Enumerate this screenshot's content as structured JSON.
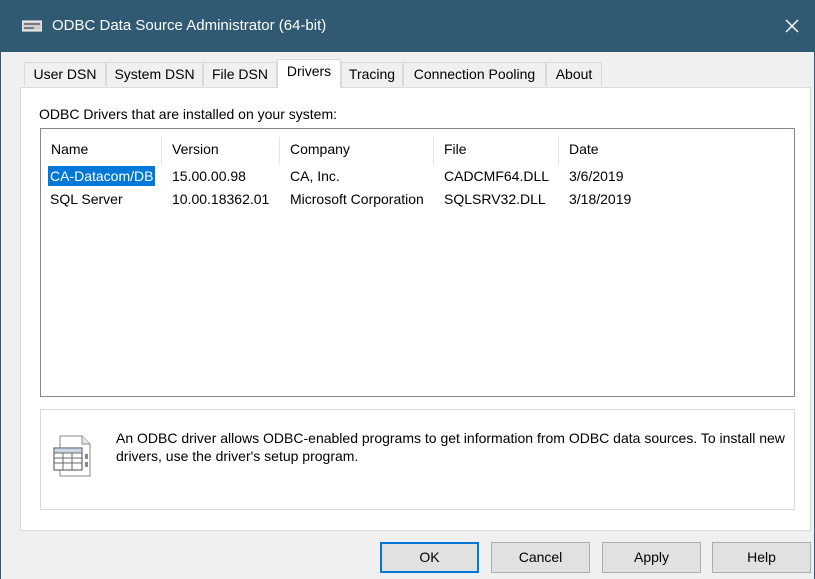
{
  "window": {
    "title": "ODBC Data Source Administrator (64-bit)",
    "close_glyph": "✕"
  },
  "tabs": [
    {
      "label": "User DSN"
    },
    {
      "label": "System DSN"
    },
    {
      "label": "File DSN"
    },
    {
      "label": "Drivers",
      "active": true
    },
    {
      "label": "Tracing"
    },
    {
      "label": "Connection Pooling"
    },
    {
      "label": "About"
    }
  ],
  "drivers_panel": {
    "installed_label": "ODBC Drivers that are installed on your system:",
    "columns": [
      "Name",
      "Version",
      "Company",
      "File",
      "Date"
    ],
    "rows": [
      {
        "name": "CA-Datacom/DB",
        "version": "15.00.00.98",
        "company": "CA, Inc.",
        "file": "CADCMF64.DLL",
        "date": "3/6/2019",
        "selected": true
      },
      {
        "name": "SQL Server",
        "version": "10.00.18362.01",
        "company": "Microsoft Corporation",
        "file": "SQLSRV32.DLL",
        "date": "3/18/2019",
        "selected": false
      }
    ],
    "description": "An ODBC driver allows ODBC-enabled programs to get information from ODBC data sources.  To install new drivers, use the driver's setup program.",
    "description_icon": "driver-document-icon"
  },
  "buttons": {
    "ok": "OK",
    "cancel": "Cancel",
    "apply": "Apply",
    "help": "Help"
  },
  "colors": {
    "titlebar": "#305a74",
    "selection": "#0078d7"
  }
}
